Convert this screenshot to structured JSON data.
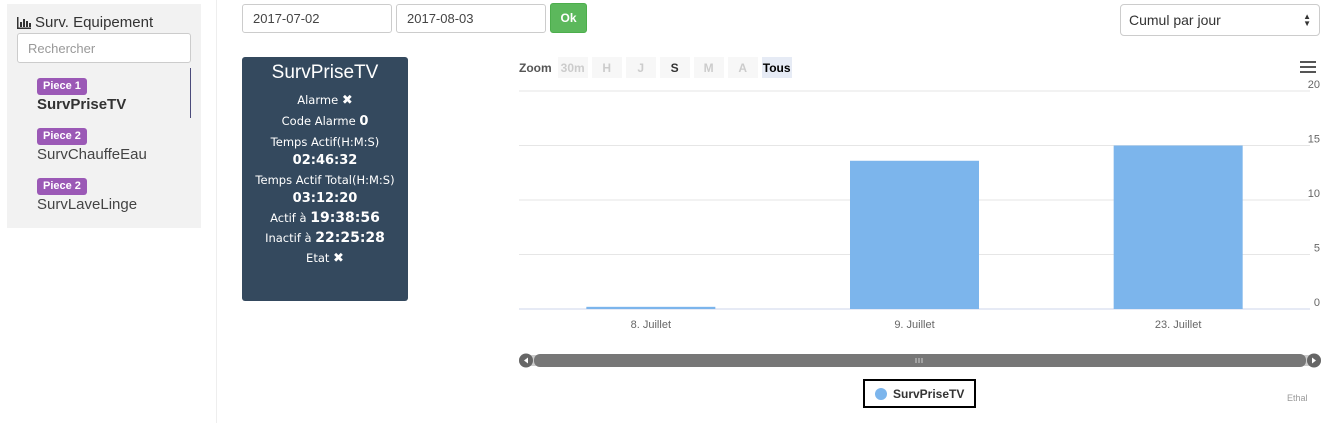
{
  "sidebar": {
    "title": "Surv. Equipement",
    "search_placeholder": "Rechercher",
    "items": [
      {
        "badge": "Piece 1",
        "name": "SurvPriseTV"
      },
      {
        "badge": "Piece 2",
        "name": "SurvChauffeEau"
      },
      {
        "badge": "Piece 2",
        "name": "SurvLaveLinge"
      }
    ]
  },
  "toolbar": {
    "date_from": "2017-07-02",
    "date_to": "2017-08-03",
    "ok_label": "Ok",
    "mode_select": "Cumul par jour"
  },
  "card": {
    "title": "SurvPriseTV",
    "alarme_label": "Alarme",
    "alarme_value": "✖",
    "code_alarme_label": "Code Alarme",
    "code_alarme_value": "0",
    "temps_actif_label": "Temps Actif(H:M:S)",
    "temps_actif_value": "02:46:32",
    "temps_total_label": "Temps Actif Total(H:M:S)",
    "temps_total_value": "03:12:20",
    "actif_label": "Actif à",
    "actif_value": "19:38:56",
    "inactif_label": "Inactif à",
    "inactif_value": "22:25:28",
    "etat_label": "Etat",
    "etat_value": "✖"
  },
  "zoom": {
    "label": "Zoom",
    "buttons": [
      "30m",
      "H",
      "J",
      "S",
      "M",
      "A",
      "Tous"
    ]
  },
  "colors": {
    "series": "#7cb5ec",
    "card_bg": "#34495e",
    "badge": "#9b59b6",
    "ok": "#5cb85c"
  },
  "credits": "Ethal",
  "chart_data": {
    "type": "bar",
    "categories": [
      "8. Juillet",
      "9. Juillet",
      "23. Juillet"
    ],
    "series": [
      {
        "name": "SurvPriseTV",
        "values": [
          0.2,
          13.6,
          15.0
        ]
      }
    ],
    "ylim": [
      0,
      20
    ],
    "yticks": [
      0,
      5,
      10,
      15,
      20
    ],
    "grid": true,
    "legend": "bottom-center",
    "y_axis_side": "right"
  }
}
